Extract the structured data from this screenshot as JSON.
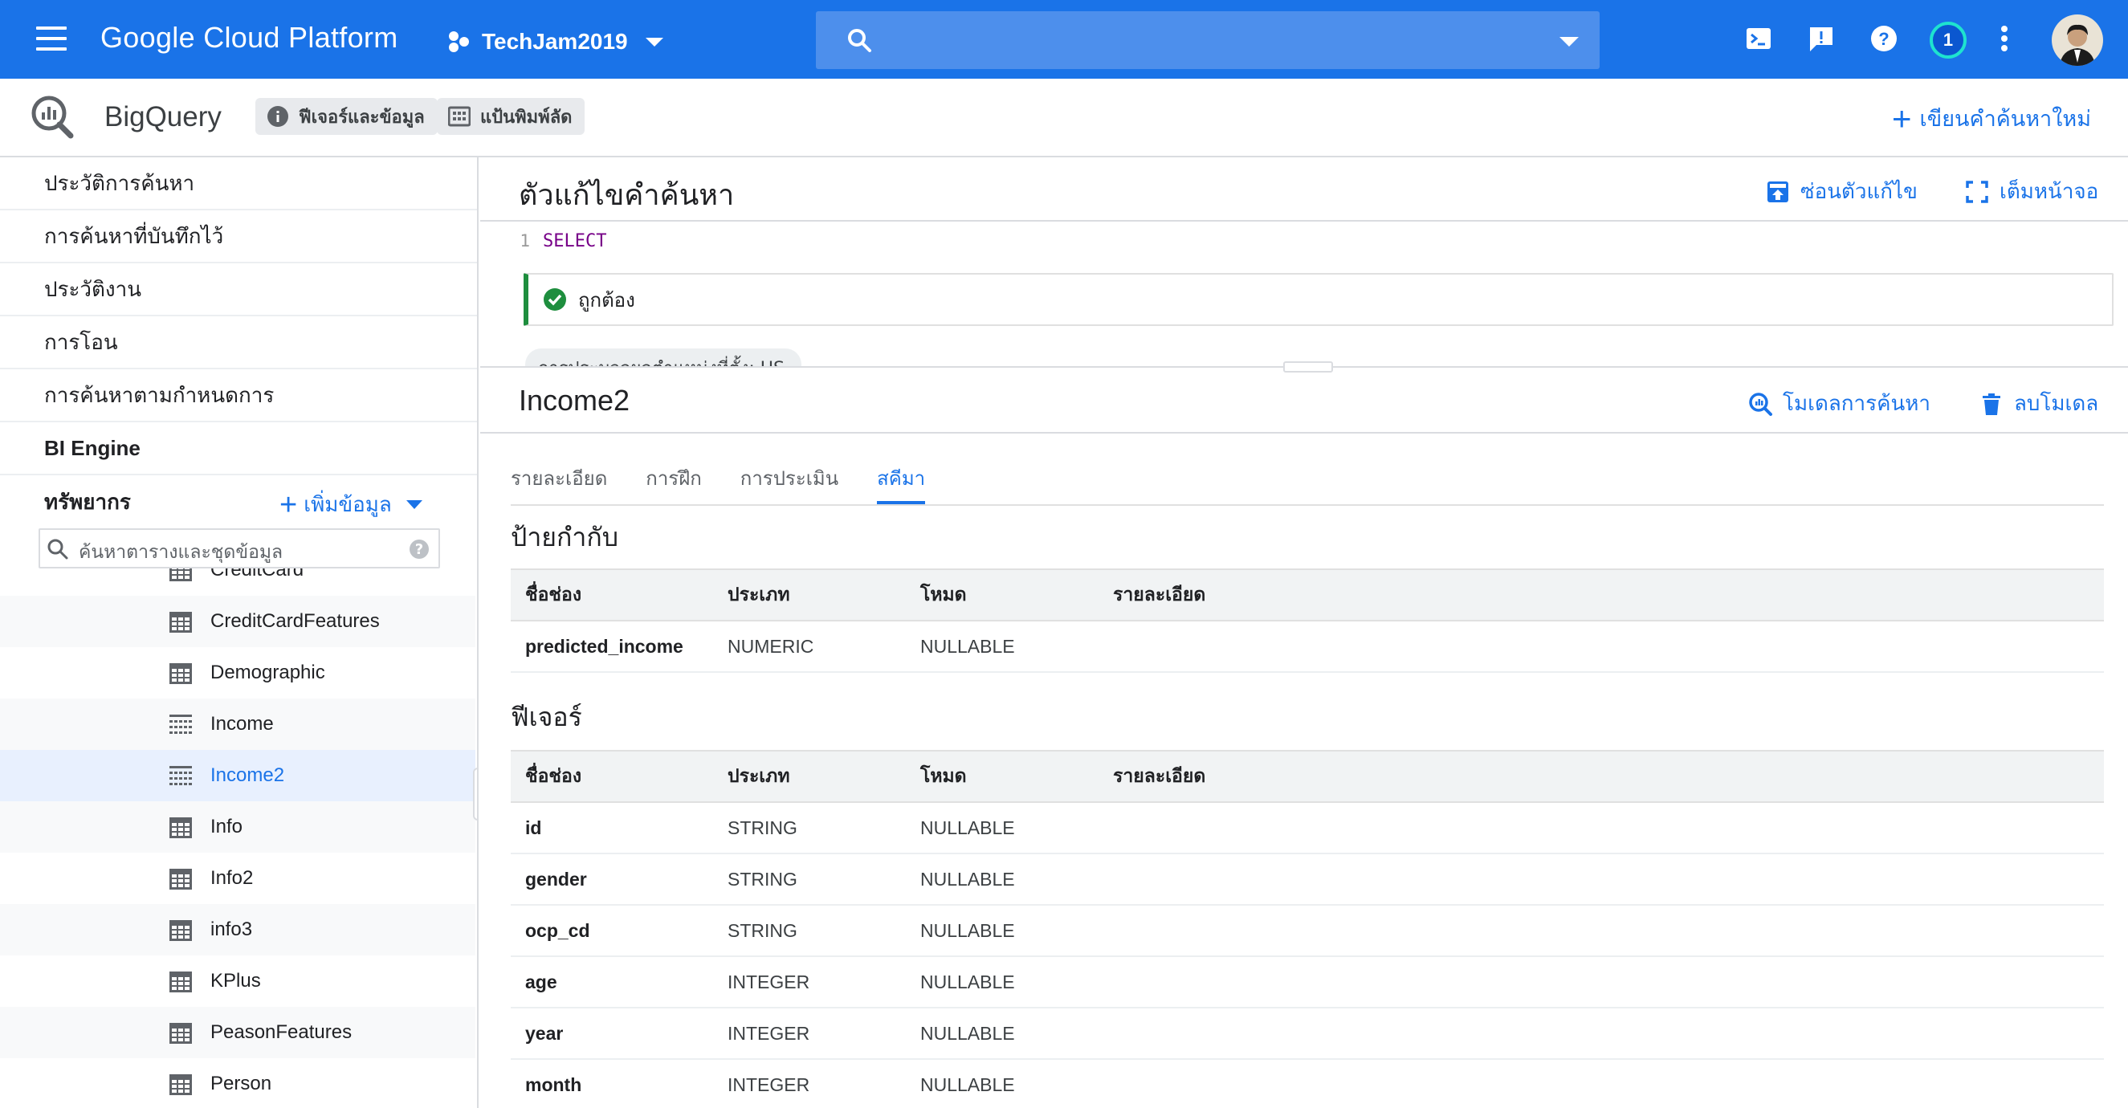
{
  "topbar": {
    "brand": "Google Cloud Platform",
    "project": "TechJam2019",
    "search_placeholder": "",
    "notifications_count": "1",
    "color": "#1a73e8"
  },
  "subheader": {
    "product": "BigQuery",
    "chip_features": "ฟีเจอร์และข้อมูล",
    "chip_shortcuts": "แป้นพิมพ์ลัด",
    "compose_label": "เขียนคำค้นหาใหม่"
  },
  "sidebar": {
    "items": [
      {
        "label": "ประวัติการค้นหา"
      },
      {
        "label": "การค้นหาที่บันทึกไว้"
      },
      {
        "label": "ประวัติงาน"
      },
      {
        "label": "การโอน"
      },
      {
        "label": "การค้นหาตามกำหนดการ"
      },
      {
        "label": "BI Engine"
      }
    ],
    "resources_label": "ทรัพยากร",
    "add_data_label": "เพิ่มข้อมูล",
    "search_placeholder": "ค้นหาตารางและชุดข้อมูล",
    "tree": [
      {
        "label": "CreditCard",
        "icon": "table-icon"
      },
      {
        "label": "CreditCardFeatures",
        "icon": "table-icon"
      },
      {
        "label": "Demographic",
        "icon": "table-icon"
      },
      {
        "label": "Income",
        "icon": "model-icon"
      },
      {
        "label": "Income2",
        "icon": "model-icon",
        "selected": true
      },
      {
        "label": "Info",
        "icon": "table-icon"
      },
      {
        "label": "Info2",
        "icon": "table-icon"
      },
      {
        "label": "info3",
        "icon": "table-icon"
      },
      {
        "label": "KPlus",
        "icon": "table-icon"
      },
      {
        "label": "PeasonFeatures",
        "icon": "table-icon"
      },
      {
        "label": "Person",
        "icon": "table-icon"
      }
    ]
  },
  "editor": {
    "title": "ตัวแก้ไขคำค้นหา",
    "hide_editor": "ซ่อนตัวแก้ไข",
    "fullscreen": "เต็มหน้าจอ",
    "line_number": "1",
    "code": "SELECT",
    "validation": "ถูกต้อง",
    "location": "การประมวลผลตำแหน่งที่ตั้ง: US"
  },
  "model": {
    "name": "Income2",
    "query_model": "โมเดลการค้นหา",
    "delete_model": "ลบโมเดล",
    "tabs": [
      {
        "label": "รายละเอียด"
      },
      {
        "label": "การฝึก"
      },
      {
        "label": "การประเมิน"
      },
      {
        "label": "สคีมา",
        "active": true
      }
    ],
    "labels_heading": "ป้ายกำกับ",
    "features_heading": "ฟีเจอร์",
    "columns": {
      "name": "ชื่อช่อง",
      "type": "ประเภท",
      "mode": "โหมด",
      "desc": "รายละเอียด"
    },
    "labels": [
      {
        "name": "predicted_income",
        "type": "NUMERIC",
        "mode": "NULLABLE",
        "desc": ""
      }
    ],
    "features": [
      {
        "name": "id",
        "type": "STRING",
        "mode": "NULLABLE",
        "desc": ""
      },
      {
        "name": "gender",
        "type": "STRING",
        "mode": "NULLABLE",
        "desc": ""
      },
      {
        "name": "ocp_cd",
        "type": "STRING",
        "mode": "NULLABLE",
        "desc": ""
      },
      {
        "name": "age",
        "type": "INTEGER",
        "mode": "NULLABLE",
        "desc": ""
      },
      {
        "name": "year",
        "type": "INTEGER",
        "mode": "NULLABLE",
        "desc": ""
      },
      {
        "name": "month",
        "type": "INTEGER",
        "mode": "NULLABLE",
        "desc": ""
      }
    ]
  }
}
